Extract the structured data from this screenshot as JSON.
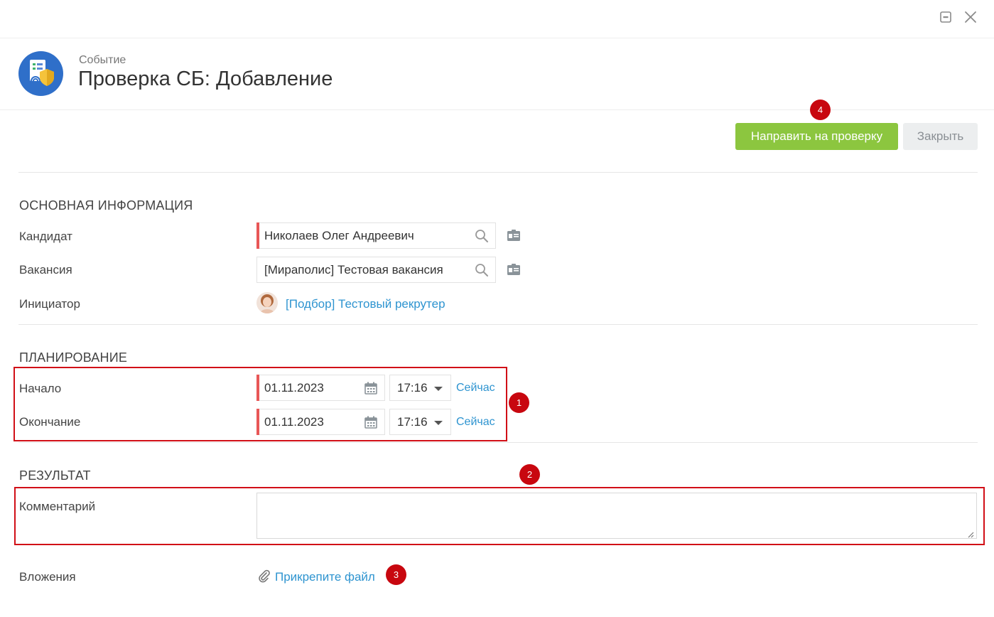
{
  "header": {
    "subtitle": "Событие",
    "title": "Проверка СБ: Добавление"
  },
  "window": {
    "minimize_icon": "minimize-icon",
    "close_icon": "close-icon"
  },
  "toolbar": {
    "submit_label": "Направить на проверку",
    "close_label": "Закрыть"
  },
  "sections": {
    "main_info": {
      "title": "ОСНОВНАЯ ИНФОРМАЦИЯ",
      "candidate_label": "Кандидат",
      "candidate_value": "Николаев Олег Андреевич",
      "vacancy_label": "Вакансия",
      "vacancy_value": "[Мираполис] Тестовая вакансия",
      "initiator_label": "Инициатор",
      "initiator_value": "[Подбор] Тестовый рекрутер"
    },
    "planning": {
      "title": "ПЛАНИРОВАНИЕ",
      "start_label": "Начало",
      "start_date": "01.11.2023",
      "start_time": "17:16",
      "end_label": "Окончание",
      "end_date": "01.11.2023",
      "end_time": "17:16",
      "now_label": "Сейчас"
    },
    "result": {
      "title": "РЕЗУЛЬТАТ",
      "comment_label": "Комментарий",
      "comment_value": "",
      "attachments_label": "Вложения",
      "attach_link": "Прикрепите файл"
    }
  },
  "markers": [
    "1",
    "2",
    "3",
    "4"
  ],
  "colors": {
    "primary_button": "#8cc63f",
    "link": "#2e94d0",
    "required": "#e85757",
    "annotation": "#d10f17"
  }
}
